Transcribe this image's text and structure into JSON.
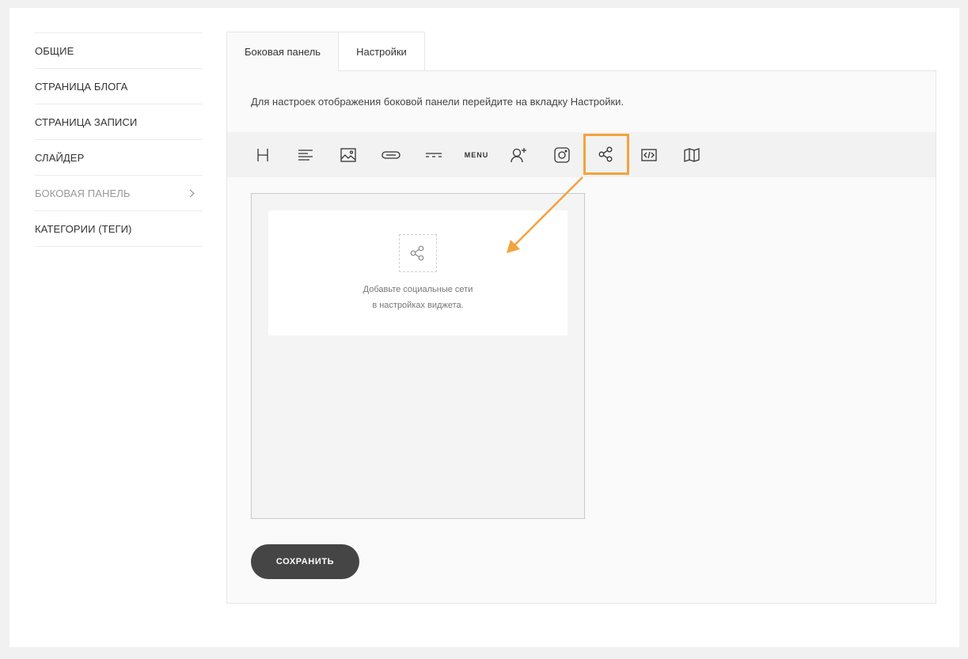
{
  "sidebar": {
    "items": [
      {
        "label": "ОБЩИЕ"
      },
      {
        "label": "СТРАНИЦА БЛОГА"
      },
      {
        "label": "СТРАНИЦА ЗАПИСИ"
      },
      {
        "label": "СЛАЙДЕР"
      },
      {
        "label": "БОКОВАЯ ПАНЕЛЬ",
        "active": true
      },
      {
        "label": "КАТЕГОРИИ (ТЕГИ)"
      }
    ]
  },
  "tabs": [
    {
      "label": "Боковая панель",
      "active": true
    },
    {
      "label": "Настройки"
    }
  ],
  "panel": {
    "hint": "Для настроек отображения боковой панели перейдите на вкладку Настройки."
  },
  "toolbar": {
    "tools": [
      {
        "icon": "heading-icon"
      },
      {
        "icon": "text-align-icon"
      },
      {
        "icon": "image-icon"
      },
      {
        "icon": "button-icon"
      },
      {
        "icon": "divider-icon"
      },
      {
        "icon": "menu-icon",
        "label": "MENU"
      },
      {
        "icon": "subscribe-user-icon"
      },
      {
        "icon": "instagram-icon"
      },
      {
        "icon": "share-icon",
        "highlighted": true
      },
      {
        "icon": "code-icon"
      },
      {
        "icon": "map-icon"
      }
    ],
    "highlight_color": "#f2a33c"
  },
  "widget": {
    "icon": "share-icon",
    "text_line1": "Добавьте социальные сети",
    "text_line2": "в настройках виджета."
  },
  "save_button": {
    "label": "СОХРАНИТЬ"
  }
}
